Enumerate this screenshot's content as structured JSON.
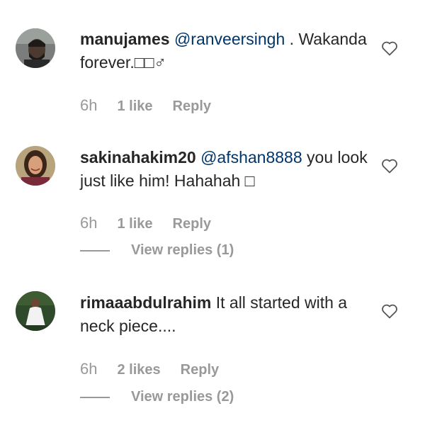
{
  "comments": [
    {
      "username": "manujames",
      "mention": "@ranveersingh",
      "text_after_mention": " . Wakanda forever.□□♂",
      "time": "6h",
      "likes": "1 like",
      "reply": "Reply",
      "avatar": "man-with-beard-avatar",
      "like_icon": "heart-outline-icon"
    },
    {
      "username": "sakinahakim20",
      "mention": "@afshan8888",
      "text_after_mention": " you look just like him! Hahahah □",
      "time": "6h",
      "likes": "1 like",
      "reply": "Reply",
      "view_replies": "View replies (1)",
      "avatar": "woman-smiling-avatar",
      "like_icon": "heart-outline-icon"
    },
    {
      "username": "rimaaabdulrahim",
      "mention": "",
      "text_after_mention": " It all started with a neck piece....",
      "time": "6h",
      "likes": "2 likes",
      "reply": "Reply",
      "view_replies": "View replies (2)",
      "avatar": "woman-white-dress-avatar",
      "like_icon": "heart-outline-icon"
    }
  ],
  "colors": {
    "text": "#262626",
    "mention": "#003569",
    "meta": "#999999",
    "background": "#ffffff"
  }
}
